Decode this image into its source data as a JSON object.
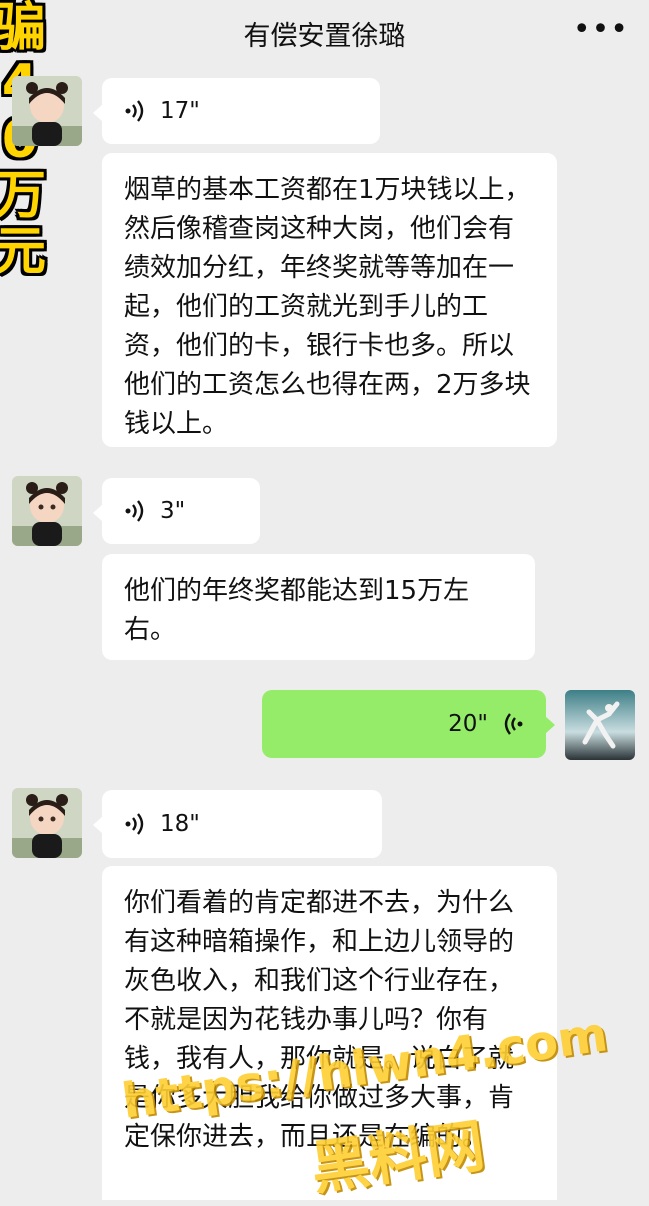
{
  "header": {
    "title": "有偿安置徐璐",
    "more_label": "•••"
  },
  "overlay": {
    "lines": [
      "骗",
      "4",
      "0",
      "万",
      "元"
    ]
  },
  "messages": [
    {
      "type": "voice",
      "duration": "17\""
    },
    {
      "type": "text",
      "text": "烟草的基本工资都在1万块钱以上，然后像稽查岗这种大岗，他们会有绩效加分红，年终奖就等等加在一起，他们的工资就光到手儿的工资，他们的卡，银行卡也多。所以他们的工资怎么也得在两，2万多块钱以上。"
    },
    {
      "type": "voice",
      "duration": "3\""
    },
    {
      "type": "text",
      "text": "他们的年终奖都能达到15万左右。"
    },
    {
      "type": "voice_self",
      "duration": "20\""
    },
    {
      "type": "voice",
      "duration": "18\""
    },
    {
      "type": "text",
      "text": "你们看着的肯定都进不去，为什么有这种暗箱操作，和上边儿领导的灰色收入，和我们这个行业存在，不就是因为花钱办事儿吗？你有钱，我有人，那你就是。说白了就是你多大胆我给你做过多大事，肯定保你进去，而且还是在编的。"
    }
  ],
  "watermark": {
    "line1": "https://hlwn4.com",
    "line2": "黑料网"
  },
  "colors": {
    "background": "#ededed",
    "bubble_self": "#95ec69",
    "bubble_other": "#ffffff",
    "overlay_text": "#ffd400"
  }
}
